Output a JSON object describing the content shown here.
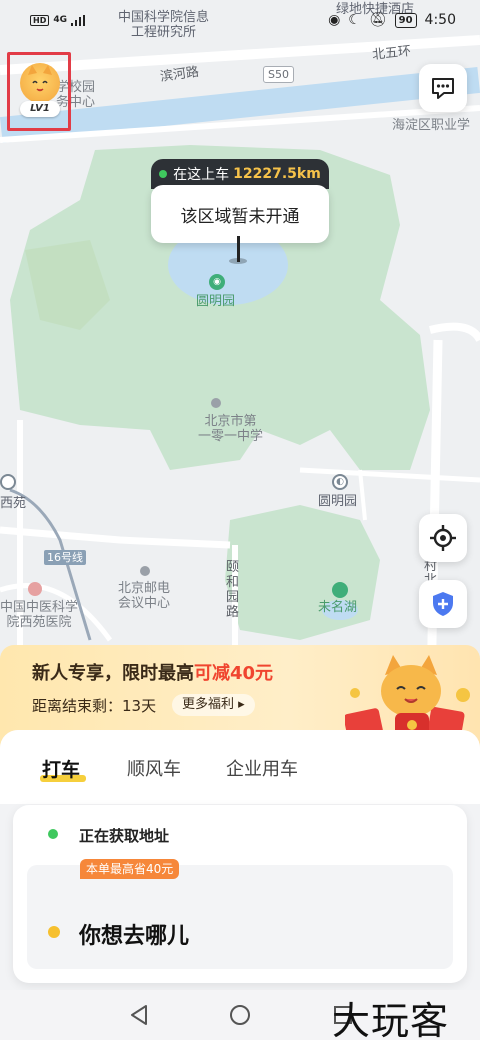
{
  "status_bar": {
    "network_hd": "HD",
    "network_type": "4G",
    "battery": "90",
    "time": "4:50"
  },
  "map": {
    "labels": {
      "cas_institute": "中国科学院信息\n工程研究所",
      "hotel": "绿地快捷酒店",
      "binhe_road": "滨河路",
      "s50": "S50",
      "north_fifth_ring": "北五环",
      "campus_center": "学校园\n务中心",
      "haidian_vocational": "海淀区职业学",
      "yuanmingyuan_park": "圆明园",
      "school_101": "北京市第\n一零一中学",
      "yuanmingyuan_station": "圆明园",
      "xiyuan": "西苑",
      "line16": "16号线",
      "tcm_hospital": "中国中医科学\n院西苑医院",
      "post_conference": "北京邮电\n会议中心",
      "yiheyuan_road": "颐\n和\n园\n路",
      "weiming_lake": "未名湖",
      "village": "村\n北"
    }
  },
  "avatar": {
    "level": "LV1"
  },
  "icons": {
    "message": "message-icon",
    "locate": "locate-icon",
    "safety": "shield-icon"
  },
  "pickup": {
    "label": "在这上车",
    "distance": "12227.5km",
    "message": "该区域暂未开通"
  },
  "promo": {
    "title_prefix": "新人专享，限时最高",
    "title_highlight": "可减40元",
    "remaining": "距离结束剩：13天",
    "more_button": "更多福利"
  },
  "tabs": [
    {
      "label": "打车",
      "active": true
    },
    {
      "label": "顺风车",
      "active": false
    },
    {
      "label": "企业用车",
      "active": false
    }
  ],
  "ride_card": {
    "from_text": "正在获取地址",
    "save_tag": "本单最高省40元",
    "to_placeholder": "你想去哪儿"
  },
  "watermark": "大玩客",
  "colors": {
    "green_area": "#c9e4cf",
    "water": "#bfdcf2",
    "accent_yellow": "#f6cf3c",
    "promo_red": "#f0452f",
    "pickup_dark": "#2d3136"
  }
}
